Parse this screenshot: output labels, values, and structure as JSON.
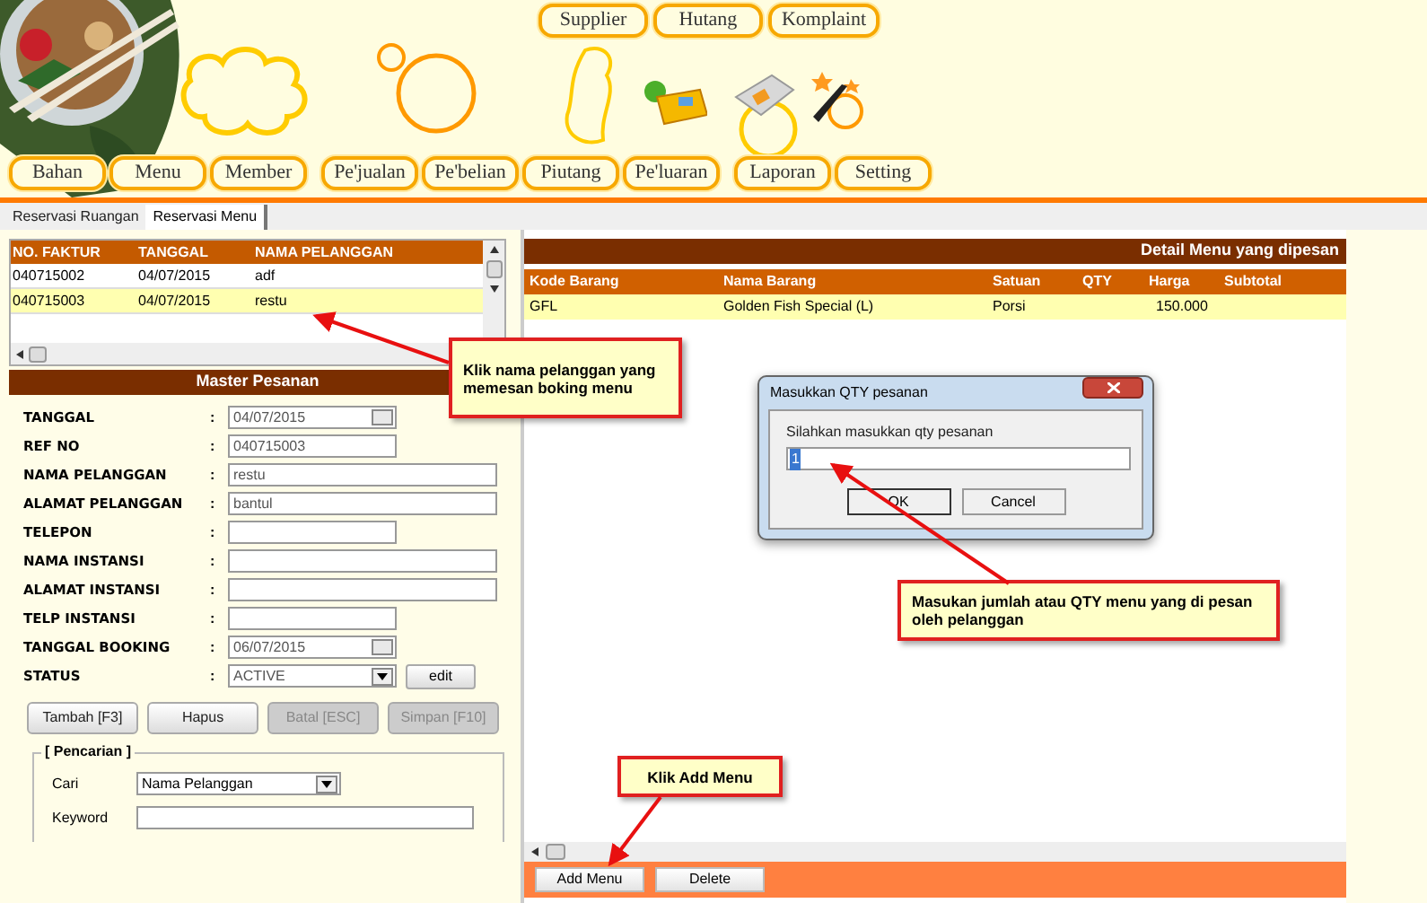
{
  "top_nav": [
    {
      "label": "Supplier"
    },
    {
      "label": "Hutang"
    },
    {
      "label": "Komplaint"
    }
  ],
  "main_nav": [
    [
      {
        "label": "Bahan"
      },
      {
        "label": "Menu"
      },
      {
        "label": "Member"
      }
    ],
    [
      {
        "label": "Pe'jualan"
      },
      {
        "label": "Pe'belian"
      },
      {
        "label": "Piutang"
      },
      {
        "label": "Pe'luaran"
      }
    ],
    [
      {
        "label": "Laporan"
      },
      {
        "label": "Setting"
      }
    ]
  ],
  "tabs": [
    {
      "label": "Reservasi Ruangan",
      "selected": false
    },
    {
      "label": "Reservasi Menu",
      "selected": true
    }
  ],
  "invoice_list": {
    "columns": [
      "NO. FAKTUR",
      "TANGGAL",
      "NAMA PELANGGAN"
    ],
    "rows": [
      {
        "cells": [
          "040715002",
          "04/07/2015",
          "adf"
        ],
        "selected": false
      },
      {
        "cells": [
          "040715003",
          "04/07/2015",
          "restu"
        ],
        "selected": true
      }
    ]
  },
  "master_form": {
    "title": "Master Pesanan",
    "separator": ":",
    "fields": [
      {
        "label": "TANGGAL",
        "kind": "date",
        "value": "04/07/2015"
      },
      {
        "label": "REF NO",
        "kind": "text",
        "value": "040715003"
      },
      {
        "label": "NAMA PELANGGAN",
        "kind": "text",
        "value": "restu"
      },
      {
        "label": "ALAMAT PELANGGAN",
        "kind": "text",
        "value": "bantul"
      },
      {
        "label": "TELEPON",
        "kind": "text"
      },
      {
        "label": "NAMA INSTANSI",
        "kind": "text"
      },
      {
        "label": "ALAMAT INSTANSI",
        "kind": "text"
      },
      {
        "label": "TELP INSTANSI",
        "kind": "text"
      },
      {
        "label": "TANGGAL BOOKING",
        "kind": "date",
        "value": "06/07/2015"
      },
      {
        "label": "STATUS",
        "kind": "select",
        "value": "ACTIVE",
        "button": "edit"
      }
    ],
    "buttons": [
      {
        "label": "Tambah [F3]",
        "disabled": false
      },
      {
        "label": "Hapus",
        "disabled": false
      },
      {
        "label": "Batal [ESC]",
        "disabled": true
      },
      {
        "label": "Simpan [F10]",
        "disabled": true
      }
    ]
  },
  "search": {
    "title": "[ Pencarian ]",
    "fields": [
      {
        "label": "Cari",
        "kind": "select",
        "value": "Nama Pelanggan"
      },
      {
        "label": "Keyword",
        "kind": "text"
      }
    ]
  },
  "detail": {
    "title": "Detail Menu yang dipesan",
    "columns": [
      "Kode Barang",
      "Nama Barang",
      "Satuan",
      "QTY",
      "Harga",
      "Subtotal"
    ],
    "rows": [
      {
        "kode_barang": "GFL",
        "nama_barang": "Golden Fish Special (L)",
        "satuan": "Porsi",
        "harga": "150.000",
        "selected": true
      }
    ]
  },
  "footer_buttons": [
    "Add Menu",
    "Delete"
  ],
  "dialog": {
    "title": "Masukkan QTY pesanan",
    "prompt": "Silahkan masukkan qty pesanan",
    "value": "1",
    "buttons": [
      "OK",
      "Cancel"
    ]
  },
  "callouts": [
    {
      "text": "Klik nama pelanggan yang memesan boking menu"
    },
    {
      "text": "Masukan jumlah atau QTY menu yang di pesan oleh pelanggan"
    },
    {
      "text": "Klik Add Menu"
    }
  ]
}
